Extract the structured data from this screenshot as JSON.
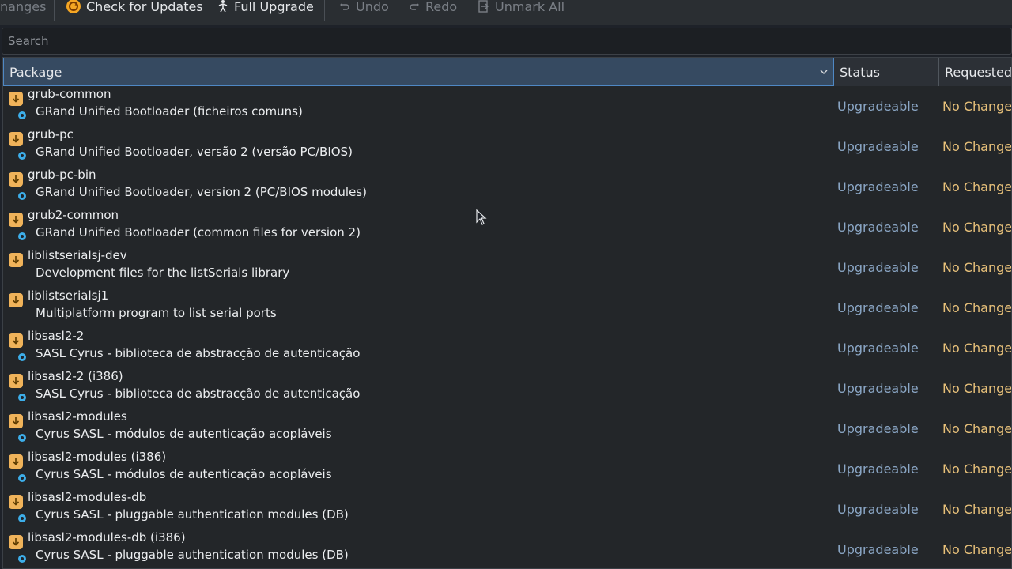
{
  "toolbar": {
    "apply_changes_label": "nanges",
    "check_updates_label": "Check for Updates",
    "full_upgrade_label": "Full Upgrade",
    "undo_label": "Undo",
    "redo_label": "Redo",
    "unmark_all_label": "Unmark All"
  },
  "search": {
    "placeholder": "Search",
    "value": ""
  },
  "table": {
    "columns": {
      "package": "Package",
      "status": "Status",
      "requested": "Requested"
    },
    "rows": [
      {
        "name": "grub-common",
        "description": "GRand Unified Bootloader (ficheiros comuns)",
        "status": "Upgradeable",
        "requested": "No Change"
      },
      {
        "name": "grub-pc",
        "description": "GRand Unified Bootloader, versão 2 (versão PC/BIOS)",
        "status": "Upgradeable",
        "requested": "No Change"
      },
      {
        "name": "grub-pc-bin",
        "description": "GRand Unified Bootloader, version 2 (PC/BIOS modules)",
        "status": "Upgradeable",
        "requested": "No Change"
      },
      {
        "name": "grub2-common",
        "description": "GRand Unified Bootloader (common files for version 2)",
        "status": "Upgradeable",
        "requested": "No Change"
      },
      {
        "name": "liblistserialsj-dev",
        "description": "Development files for the listSerials library",
        "status": "Upgradeable",
        "requested": "No Change"
      },
      {
        "name": "liblistserialsj1",
        "description": "Multiplatform program to list serial ports",
        "status": "Upgradeable",
        "requested": "No Change"
      },
      {
        "name": "libsasl2-2",
        "description": "SASL Cyrus - biblioteca de abstracção de autenticação",
        "status": "Upgradeable",
        "requested": "No Change"
      },
      {
        "name": "libsasl2-2 (i386)",
        "description": "SASL Cyrus - biblioteca de abstracção de autenticação",
        "status": "Upgradeable",
        "requested": "No Change"
      },
      {
        "name": "libsasl2-modules",
        "description": "Cyrus SASL - módulos de autenticação acopláveis",
        "status": "Upgradeable",
        "requested": "No Change"
      },
      {
        "name": "libsasl2-modules (i386)",
        "description": "Cyrus SASL - módulos de autenticação acopláveis",
        "status": "Upgradeable",
        "requested": "No Change"
      },
      {
        "name": "libsasl2-modules-db",
        "description": "Cyrus SASL - pluggable authentication modules (DB)",
        "status": "Upgradeable",
        "requested": "No Change"
      },
      {
        "name": "libsasl2-modules-db (i386)",
        "description": "Cyrus SASL - pluggable authentication modules (DB)",
        "status": "Upgradeable",
        "requested": "No Change"
      }
    ]
  },
  "colors": {
    "status": "#8ba7c6",
    "requested": "#e8c17a",
    "package_icon": "#f0b35a",
    "header_selected": "#364a61"
  }
}
